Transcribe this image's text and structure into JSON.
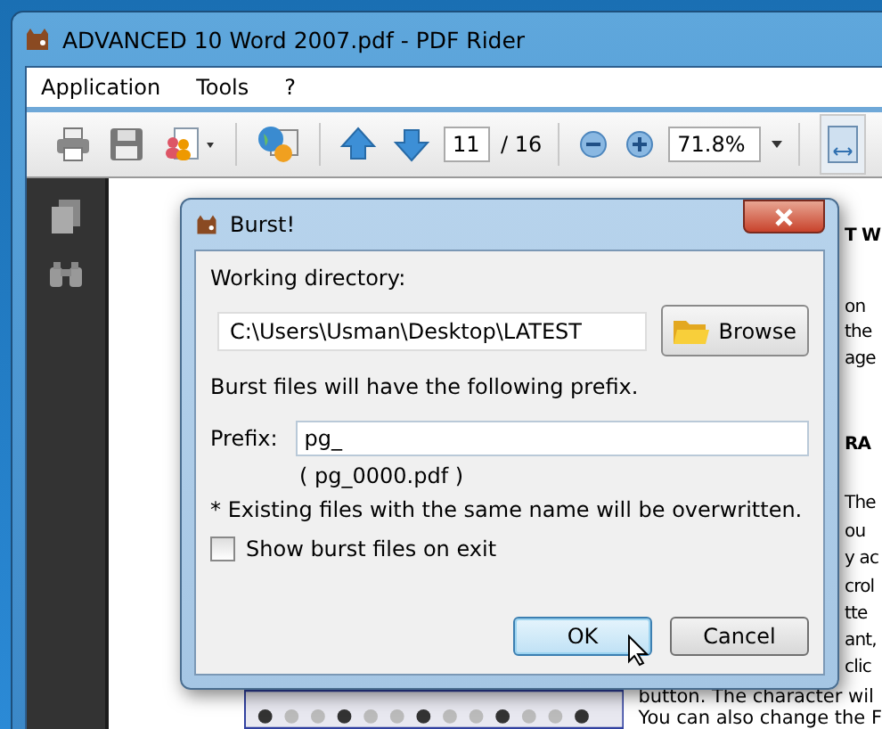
{
  "window": {
    "title": "ADVANCED 10 Word 2007.pdf - PDF Rider"
  },
  "menu": [
    "Application",
    "Tools",
    "?"
  ],
  "toolbar": {
    "page": "11",
    "page_total": "/ 16",
    "zoom": "71.8%"
  },
  "document": {
    "right_fragments": [
      "T W",
      "on",
      "the",
      "age",
      "RA",
      "The",
      "ou",
      "y ac",
      "crol",
      "tte",
      "ant,",
      "clic"
    ],
    "bottom_lines": [
      "button.  The character wil",
      "You can also change the F"
    ]
  },
  "dialog": {
    "title": "Burst!",
    "directory_label": "Working directory:",
    "directory": "C:\\Users\\Usman\\Desktop\\LATEST",
    "browse": "Browse",
    "prefix_info": "Burst files will have the following prefix.",
    "prefix_label": "Prefix:",
    "prefix": "pg_",
    "example": "( pg_0000.pdf )",
    "warning": "* Existing files with the same name will be overwritten.",
    "show_on_exit": {
      "label": "Show burst files on exit",
      "checked": false
    },
    "buttons": [
      {
        "label": "OK",
        "selected": true
      },
      {
        "label": "Cancel",
        "selected": false
      }
    ]
  }
}
